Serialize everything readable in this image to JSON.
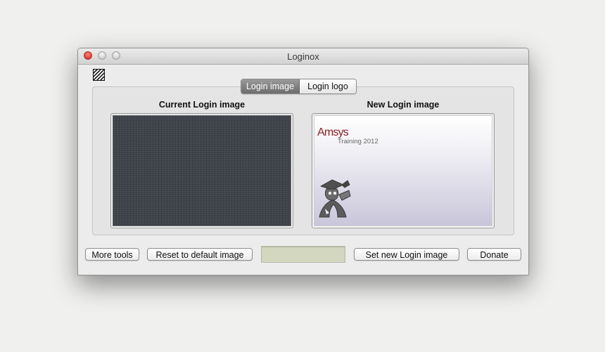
{
  "window": {
    "title": "Loginox"
  },
  "icons": {
    "app_icon": "striped-square-icon",
    "mascot": "graduate-mascot-icon"
  },
  "tabs": [
    {
      "label": "Login image",
      "selected": true
    },
    {
      "label": "Login logo",
      "selected": false
    }
  ],
  "current": {
    "label": "Current Login image"
  },
  "new": {
    "label": "New Login image",
    "brand": "Amsys",
    "subtitle": "Training 2012"
  },
  "buttons": {
    "more_tools": "More tools",
    "reset": "Reset to default image",
    "set_new": "Set new Login image",
    "donate": "Donate"
  },
  "input": {
    "value": ""
  },
  "colors": {
    "brand_red": "#8c1d24",
    "selected_tab": "#7d7d7d",
    "close_button": "#e0443e",
    "field_fill": "#d4d7bf"
  }
}
